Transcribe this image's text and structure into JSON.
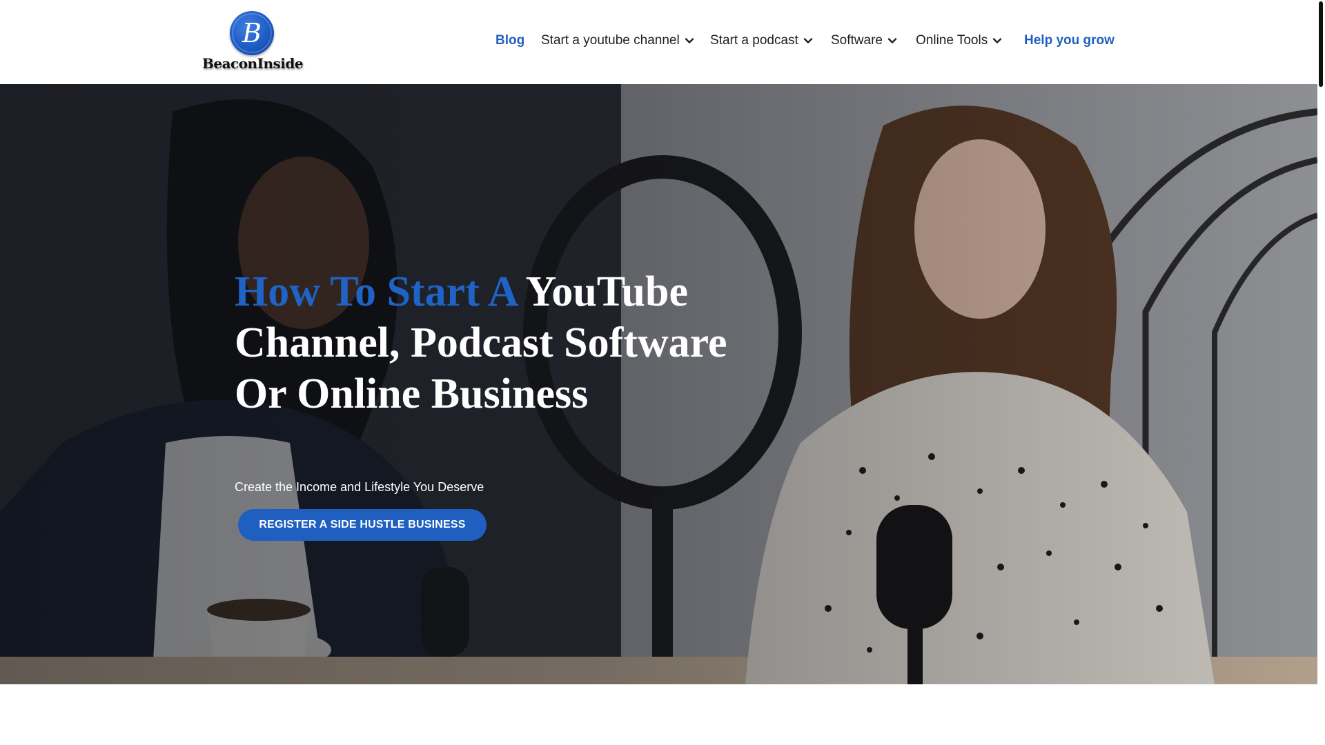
{
  "brand": {
    "logo_letter": "B",
    "logo_text": "BeaconInside",
    "accent_color": "#1f5fbf"
  },
  "nav": {
    "items": [
      {
        "label": "Blog",
        "accent": true,
        "dropdown": false
      },
      {
        "label": "Start a youtube channel",
        "accent": false,
        "dropdown": true,
        "icon": "chevron-down-icon"
      },
      {
        "label": "Start a podcast",
        "accent": false,
        "dropdown": true,
        "icon": "chevron-down-icon"
      },
      {
        "label": "Software",
        "accent": false,
        "dropdown": true,
        "icon": "chevron-down-icon"
      },
      {
        "label": "Online Tools",
        "accent": false,
        "dropdown": true,
        "icon": "chevron-down-icon"
      },
      {
        "label": "Help you grow",
        "accent": true,
        "dropdown": false
      }
    ]
  },
  "hero": {
    "headline_highlight": "How To Start A",
    "headline_rest": "YouTube Channel, Podcast Software Or Online Business",
    "subheadline": "Create the Income and Lifestyle You Deserve",
    "cta_label": "REGISTER A SIDE HUSTLE BUSINESS",
    "background_image": "two women recording a podcast with microphones and a ring light"
  }
}
